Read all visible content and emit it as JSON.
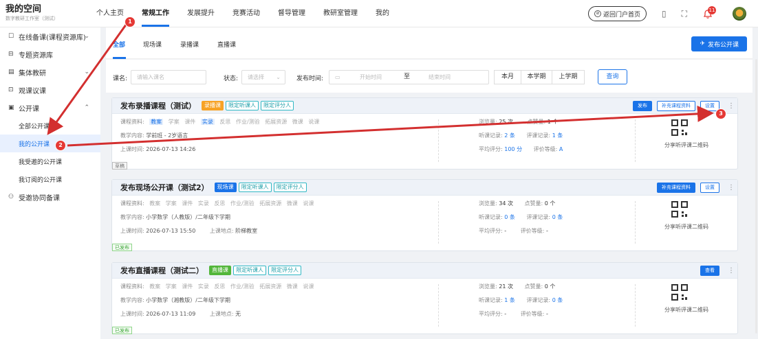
{
  "brand": {
    "title": "我的空间",
    "subtitle": "数字教研工作室（测试）"
  },
  "topnav": [
    "个人主页",
    "常规工作",
    "发展提升",
    "竞赛活动",
    "督导管理",
    "教研室管理",
    "我的"
  ],
  "topnav_active": "常规工作",
  "header": {
    "portal_button": "返回门户首页",
    "notification_count": "11"
  },
  "sidebar": {
    "items": [
      {
        "label": "在线备课(课程资源库)",
        "icon": "doc-icon",
        "chevron": "⌄"
      },
      {
        "label": "专题资源库",
        "icon": "folder-icon",
        "chevron": ""
      },
      {
        "label": "集体教研",
        "icon": "group-icon",
        "chevron": "⌄"
      },
      {
        "label": "观课议课",
        "icon": "observe-icon",
        "chevron": ""
      },
      {
        "label": "公开课",
        "icon": "public-class-icon",
        "chevron": "⌃"
      }
    ],
    "sub_items": [
      "全部公开课",
      "我的公开课",
      "我受邀的公开课",
      "我订阅的公开课"
    ],
    "active_sub": "我的公开课",
    "last_item": {
      "label": "受邀协同备课",
      "icon": "people-icon"
    }
  },
  "tabs": [
    "全部",
    "现场课",
    "录播课",
    "直播课"
  ],
  "active_tab": "全部",
  "publish_button": "发布公开课",
  "filters": {
    "course_label": "课名:",
    "course_placeholder": "请输入课名",
    "status_label": "状态:",
    "status_placeholder": "请选择",
    "time_label": "发布时间:",
    "start_placeholder": "开始时间",
    "to": "至",
    "end_placeholder": "结束时间",
    "periods": [
      "本月",
      "本学期",
      "上学期"
    ],
    "query_button": "查询"
  },
  "resource_labels": [
    "教案",
    "学案",
    "课件",
    "实录",
    "反思",
    "作业/测验",
    "拓展资源",
    "微课",
    "说课"
  ],
  "cards": [
    {
      "title": "发布录播课程（测试）",
      "type_tag": "录播课",
      "tags": [
        "限定听课人",
        "限定评分人"
      ],
      "actions": [
        "发布",
        "补充课程资料",
        "设置"
      ],
      "resources_label": "课程资料:",
      "active_resources": [
        "教案",
        "实录"
      ],
      "content_label": "教学内容:",
      "content": "学前班 - 2岁语言",
      "time_label": "上课时间:",
      "time": "2026-07-13 14:26",
      "location_label": "",
      "location": "",
      "status": "草稿",
      "views_label": "浏览量:",
      "views": "25 次",
      "likes_label": "点赞量:",
      "likes": "1 个",
      "listen_label": "听课记录:",
      "listen": "2 条",
      "eval_label": "评课记录:",
      "eval": "1 条",
      "avg_label": "平均评分:",
      "avg": "100 分",
      "level_label": "评价等级:",
      "level": "A",
      "qr_label": "分享听评课二维码"
    },
    {
      "title": "发布现场公开课（测试2）",
      "type_tag": "现场课",
      "tags": [
        "限定听课人",
        "限定评分人"
      ],
      "actions": [
        "补充课程资料",
        "设置"
      ],
      "resources_label": "课程资料:",
      "active_resources": [],
      "content_label": "教学内容:",
      "content": "小学数学（人教版）/二年级下学期",
      "time_label": "上课时间:",
      "time": "2026-07-13 15:50",
      "location_label": "上课地点:",
      "location": "阶梯教室",
      "status": "已发布",
      "views_label": "浏览量:",
      "views": "34 次",
      "likes_label": "点赞量:",
      "likes": "0 个",
      "listen_label": "听课记录:",
      "listen": "0 条",
      "eval_label": "评课记录:",
      "eval": "0 条",
      "avg_label": "平均评分:",
      "avg": "-",
      "level_label": "评价等级:",
      "level": "-",
      "qr_label": "分享听评课二维码"
    },
    {
      "title": "发布直播课程（测试二）",
      "type_tag": "直播课",
      "tags": [
        "限定听课人",
        "限定评分人"
      ],
      "actions": [
        "查看"
      ],
      "resources_label": "课程资料:",
      "active_resources": [],
      "content_label": "教学内容:",
      "content": "小学数学（湘教版）/二年级下学期",
      "time_label": "上课时间:",
      "time": "2026-07-13 11:09",
      "location_label": "上课地点:",
      "location": "无",
      "status": "已发布",
      "views_label": "浏览量:",
      "views": "21 次",
      "likes_label": "点赞量:",
      "likes": "0 个",
      "listen_label": "听课记录:",
      "listen": "1 条",
      "eval_label": "评课记录:",
      "eval": "0 条",
      "avg_label": "平均评分:",
      "avg": "-",
      "level_label": "评价等级:",
      "level": "-",
      "qr_label": "分享听评课二维码"
    }
  ],
  "annotations": [
    "1",
    "2",
    "3"
  ],
  "colors": {
    "accent": "#1a73e8",
    "annotation": "#e53935",
    "recorded_tag": "#f7a225",
    "live_tag": "#52b63a",
    "tag_outline": "#30b8c4"
  }
}
